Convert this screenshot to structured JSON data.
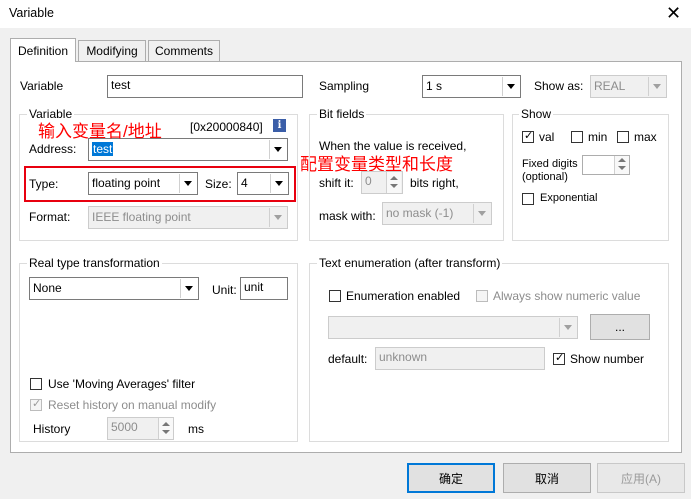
{
  "window": {
    "title": "Variable",
    "close_glyph": "✕"
  },
  "tabs": [
    {
      "label": "Definition",
      "active": true
    },
    {
      "label": "Modifying",
      "active": false
    },
    {
      "label": "Comments",
      "active": false
    }
  ],
  "variable_row": {
    "label": "Variable",
    "value": "test"
  },
  "sampling": {
    "label": "Sampling",
    "value": "1 s"
  },
  "show_as": {
    "label": "Show as:",
    "value": "REAL"
  },
  "variable_group": {
    "title": "Variable",
    "address_hint": "[0x20000840]",
    "info_icon": "i",
    "address_label": "Address:",
    "address_value": "test",
    "type_label": "Type:",
    "type_value": "floating point",
    "size_label": "Size:",
    "size_value": "4",
    "format_label": "Format:",
    "format_value": "IEEE floating point"
  },
  "annotations": {
    "address_note": "输入变量名/地址",
    "type_note": "配置变量类型和长度",
    "color": "#ff0000"
  },
  "bit_fields": {
    "title": "Bit fields",
    "description": "When the value is received,",
    "shift_label": "shift it:",
    "shift_value": "0",
    "shift_suffix": "bits right,",
    "mask_label": "mask with:",
    "mask_value": "no mask (-1)"
  },
  "show_group": {
    "title": "Show",
    "val": {
      "label": "val",
      "checked": true
    },
    "min": {
      "label": "min",
      "checked": false
    },
    "max": {
      "label": "max",
      "checked": false
    },
    "fixed_digits_label": "Fixed digits",
    "fixed_digits_note": "(optional)",
    "fixed_digits_value": "",
    "exponential": {
      "label": "Exponential",
      "checked": false
    }
  },
  "real_type": {
    "title": "Real type transformation",
    "transform_value": "None",
    "unit_label": "Unit:",
    "unit_value": "unit",
    "moving_avg": {
      "label": "Use 'Moving Averages' filter",
      "checked": false
    },
    "reset_history": {
      "label": "Reset history on manual modify",
      "checked": true
    },
    "history_label": "History",
    "history_value": "5000",
    "history_unit": "ms"
  },
  "text_enum": {
    "title": "Text enumeration (after transform)",
    "enabled": {
      "label": "Enumeration enabled",
      "checked": false
    },
    "always_numeric": {
      "label": "Always show numeric value",
      "checked": false
    },
    "combo_value": "",
    "browse_label": "...",
    "default_label": "default:",
    "default_value": "unknown",
    "show_number": {
      "label": "Show number",
      "checked": true
    }
  },
  "buttons": {
    "ok": "确定",
    "cancel": "取消",
    "apply": "应用(A)"
  }
}
